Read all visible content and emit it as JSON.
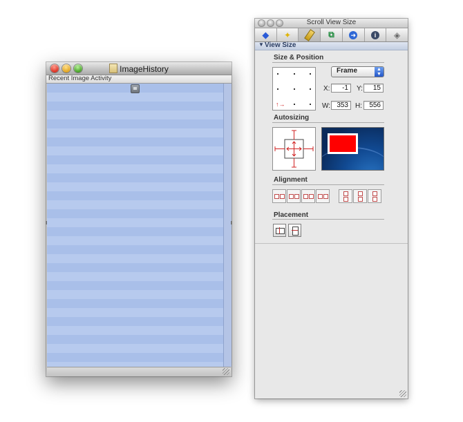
{
  "document_window": {
    "title": "ImageHistory",
    "column_header": "Recent Image Activity"
  },
  "inspector": {
    "title": "Scroll View Size",
    "toolbar_tabs": [
      {
        "icon": "bindings-icon"
      },
      {
        "icon": "effects-icon"
      },
      {
        "icon": "size-ruler-icon",
        "selected": true
      },
      {
        "icon": "connections-icon"
      },
      {
        "icon": "arrow-icon"
      },
      {
        "icon": "info-icon"
      },
      {
        "icon": "accessibility-icon"
      }
    ],
    "section": "View Size",
    "size_position": {
      "heading": "Size & Position",
      "popup_value": "Frame",
      "x_label": "X:",
      "x_value": "-1",
      "y_label": "Y:",
      "y_value": "15",
      "w_label": "W:",
      "w_value": "353",
      "h_label": "H:",
      "h_value": "556"
    },
    "autosizing_heading": "Autosizing",
    "alignment_heading": "Alignment",
    "placement_heading": "Placement"
  },
  "colors": {
    "table_row_a": "#a9bfe9",
    "table_row_b": "#b7caee",
    "autosize_red": "#ff0000",
    "section_text": "#2c3e63"
  }
}
